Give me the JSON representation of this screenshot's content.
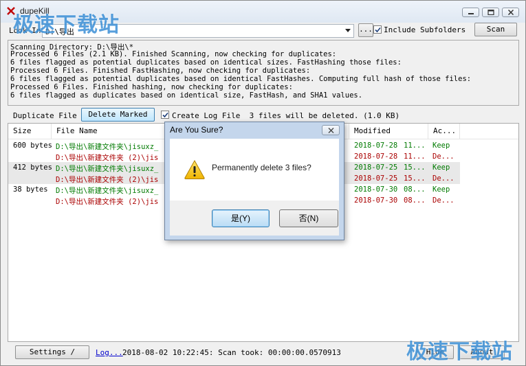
{
  "window": {
    "title": "dupeKill"
  },
  "lookin": {
    "label": "Look In:",
    "value": "D:\\导出",
    "browse_label": "..."
  },
  "include_subfolders": {
    "label": "Include Subfolders",
    "checked": true
  },
  "scan_label": "Scan",
  "log_lines": [
    "Scanning Directory: D:\\导出\\*",
    "Processed 6 Files (2.1 KB). Finished Scanning, now checking for duplicates:",
    "6 files flagged as potential duplicates based on identical sizes. FastHashing those files:",
    "Processed 6 Files. Finished FastHashing, now checking for duplicates:",
    "6 files flagged as potential duplicates based on identical FastHashes. Computing full hash of those files:",
    "Processed 6 Files. Finished hashing, now checking for duplicates:",
    "6 files flagged as duplicates based on identical size, FastHash, and SHA1 values."
  ],
  "toolbar": {
    "dup_label": "Duplicate File L",
    "delete_label": "Delete Marked",
    "create_log_label": "Create Log File",
    "create_log_checked": true,
    "summary": "3 files will be deleted. (1.0 KB)"
  },
  "list": {
    "columns": [
      "Size",
      "File Name",
      "Modified",
      "Ac..."
    ],
    "groups": [
      {
        "size": "600 bytes",
        "files": [
          {
            "name": "D:\\导出\\新建文件夹\\jisuxz_",
            "modified": "2018-07-28",
            "time": "11...",
            "action": "Keep"
          },
          {
            "name": "D:\\导出\\新建文件夹 (2)\\jis",
            "modified": "2018-07-28",
            "time": "11...",
            "action": "De..."
          }
        ]
      },
      {
        "size": "412 bytes",
        "files": [
          {
            "name": "D:\\导出\\新建文件夹\\jisuxz_",
            "modified": "2018-07-25",
            "time": "15...",
            "action": "Keep"
          },
          {
            "name": "D:\\导出\\新建文件夹 (2)\\jis",
            "modified": "2018-07-25",
            "time": "15...",
            "action": "De..."
          }
        ]
      },
      {
        "size": "38 bytes",
        "files": [
          {
            "name": "D:\\导出\\新建文件夹\\jisuxz_",
            "modified": "2018-07-30",
            "time": "08...",
            "action": "Keep"
          },
          {
            "name": "D:\\导出\\新建文件夹 (2)\\jis",
            "modified": "2018-07-30",
            "time": "08...",
            "action": "De..."
          }
        ]
      }
    ]
  },
  "bottom": {
    "settings_label": "Settings /",
    "log_link": "Log...",
    "status": "2018-08-02 10:22:45: Scan took: 00:00:00.0570913",
    "hide_label": "Hide",
    "about_label": "About"
  },
  "watermark": "极速下载站",
  "dialog": {
    "title": "Are You Sure?",
    "message": "Permanently delete 3 files?",
    "yes_label": "是(Y)",
    "no_label": "否(N)"
  },
  "colors": {
    "keep": "#007a00",
    "delete": "#aa0000",
    "link": "#0000cc",
    "watermark": "#3b8fd6"
  }
}
